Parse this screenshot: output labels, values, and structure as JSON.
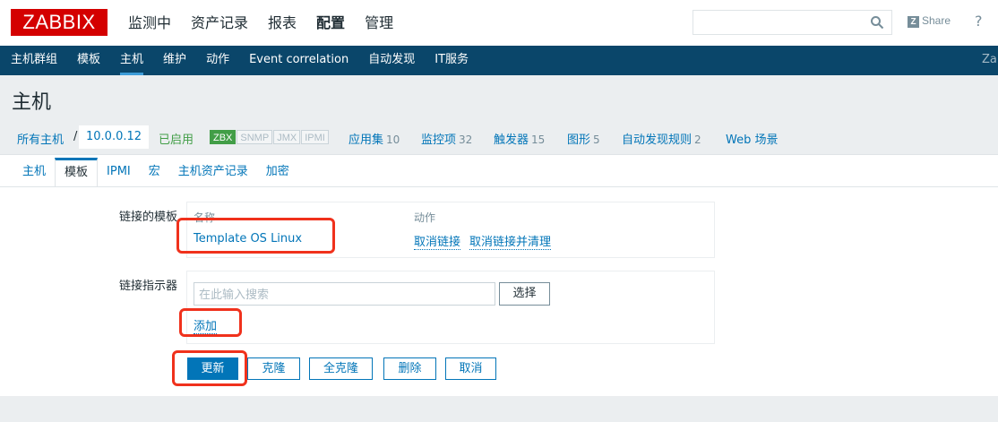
{
  "header": {
    "logo": "ZABBIX",
    "menu": [
      "监测中",
      "资产记录",
      "报表",
      "配置",
      "管理"
    ],
    "search_value": "",
    "share": "Share",
    "help": "?"
  },
  "subnav": {
    "items": [
      "主机群组",
      "模板",
      "主机",
      "维护",
      "动作",
      "Event correlation",
      "自动发现",
      "IT服务"
    ],
    "overflow": "Zab"
  },
  "page": {
    "title": "主机"
  },
  "breadcrumb": {
    "all_hosts": "所有主机",
    "separator": "/",
    "host": "10.0.0.12",
    "status": "已启用",
    "badges": [
      "ZBX",
      "SNMP",
      "JMX",
      "IPMI"
    ],
    "links": [
      {
        "label": "应用集",
        "count": "10"
      },
      {
        "label": "监控项",
        "count": "32"
      },
      {
        "label": "触发器",
        "count": "15"
      },
      {
        "label": "图形",
        "count": "5"
      },
      {
        "label": "自动发现规则",
        "count": "2"
      },
      {
        "label": "Web 场景",
        "count": ""
      }
    ]
  },
  "tabs": [
    "主机",
    "模板",
    "IPMI",
    "宏",
    "主机资产记录",
    "加密"
  ],
  "linked_templates": {
    "label": "链接的模板",
    "col_name": "名称",
    "col_action": "动作",
    "template": "Template OS Linux",
    "unlink": "取消链接",
    "unlink_clear": "取消链接并清理"
  },
  "link_indicator": {
    "label": "链接指示器",
    "placeholder": "在此输入搜索",
    "select_button": "选择",
    "add": "添加"
  },
  "buttons": {
    "update": "更新",
    "clone": "克隆",
    "full_clone": "全克隆",
    "delete": "删除",
    "cancel": "取消"
  }
}
